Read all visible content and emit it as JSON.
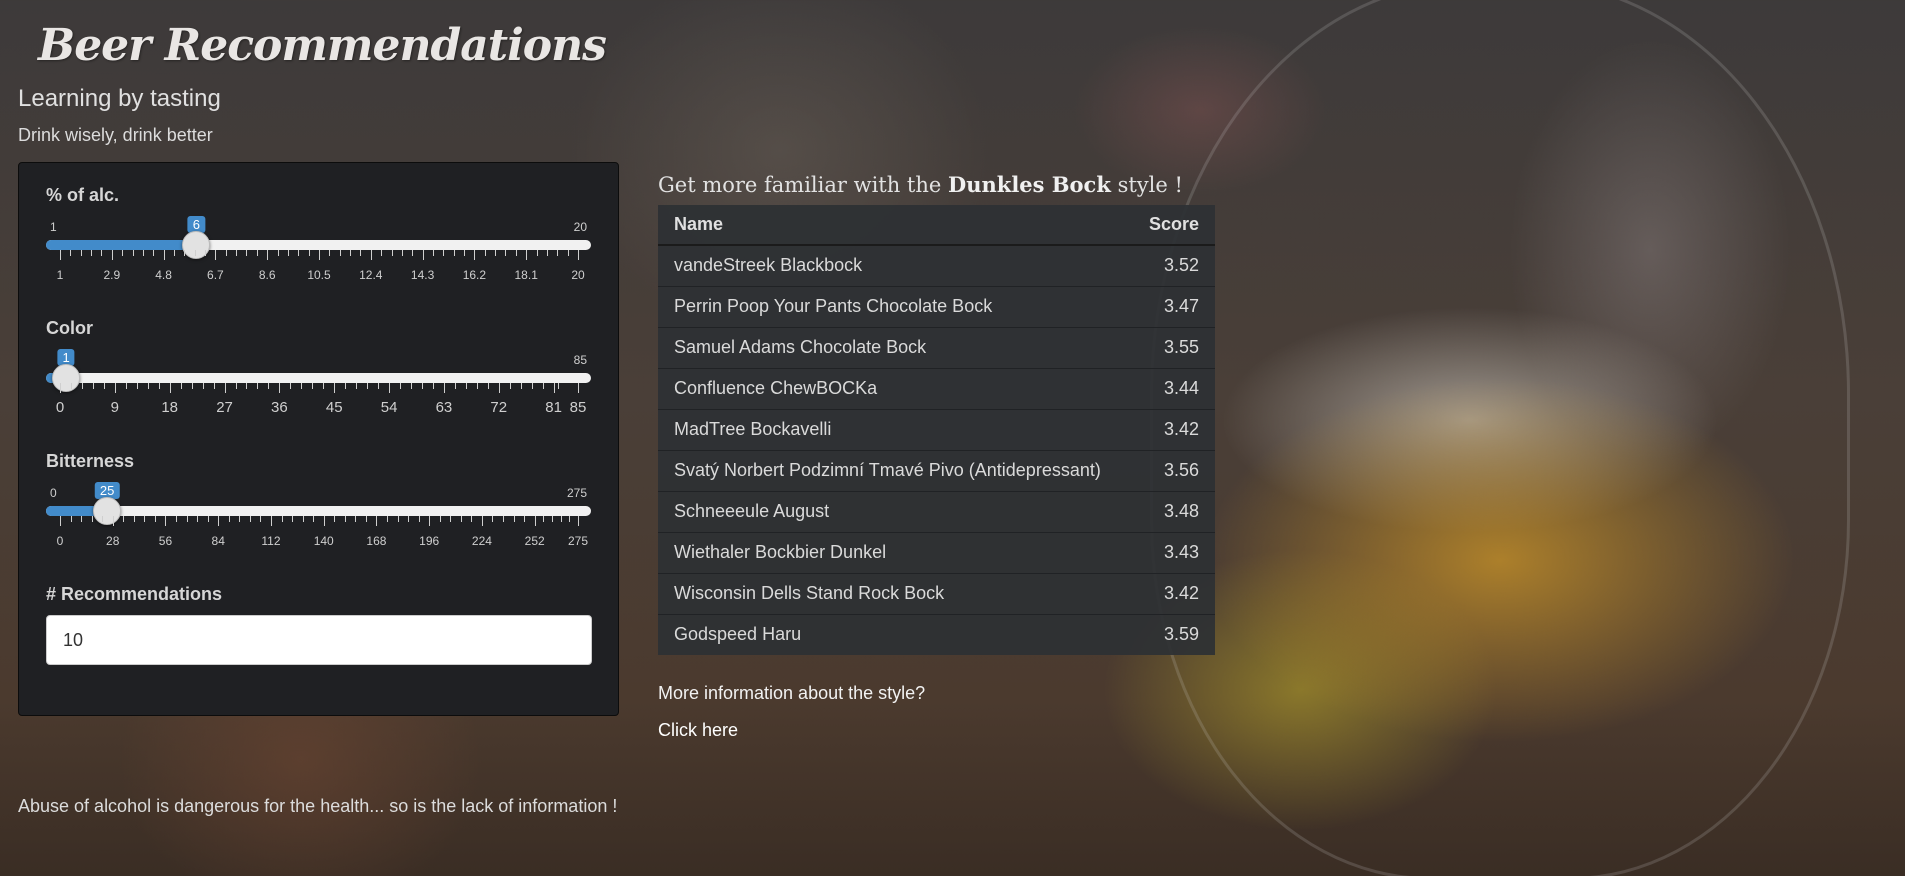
{
  "app": {
    "title": "Beer Recommendations",
    "subtitle": "Learning by tasting",
    "tagline": "Drink wisely, drink better"
  },
  "sidebar": {
    "alcohol": {
      "label": "% of alc.",
      "min": "1",
      "max": "20",
      "value": 6,
      "range_min": 1,
      "range_max": 20,
      "grid": [
        "1",
        "2.9",
        "4.8",
        "6.7",
        "8.6",
        "10.5",
        "12.4",
        "14.3",
        "16.2",
        "18.1",
        "20"
      ]
    },
    "color": {
      "label": "Color",
      "min": "0",
      "max": "85",
      "value": 1,
      "range_min": 0,
      "range_max": 85,
      "grid": [
        "0",
        "9",
        "18",
        "27",
        "36",
        "45",
        "54",
        "63",
        "72",
        "81",
        "85"
      ]
    },
    "bitterness": {
      "label": "Bitterness",
      "min": "0",
      "max": "275",
      "value": 25,
      "range_min": 0,
      "range_max": 275,
      "grid": [
        "0",
        "28",
        "56",
        "84",
        "112",
        "140",
        "168",
        "196",
        "224",
        "252",
        "275"
      ]
    },
    "recommendations": {
      "label": "# Recommendations",
      "value": "10"
    }
  },
  "main": {
    "heading_prefix": "Get more familiar with the",
    "style_name": "Dunkles Bock",
    "heading_suffix": "style !",
    "table": {
      "headers": [
        "Name",
        "Score"
      ],
      "rows": [
        [
          "vandeStreek Blackbock",
          "3.52"
        ],
        [
          "Perrin Poop Your Pants Chocolate Bock",
          "3.47"
        ],
        [
          "Samuel Adams Chocolate Bock",
          "3.55"
        ],
        [
          "Confluence ChewBOCKa",
          "3.44"
        ],
        [
          "MadTree Bockavelli",
          "3.42"
        ],
        [
          "Svatý Norbert Podzimní Tmavé Pivo (Antidepressant)",
          "3.56"
        ],
        [
          "Schneeeule August",
          "3.48"
        ],
        [
          "Wiethaler Bockbier Dunkel",
          "3.43"
        ],
        [
          "Wisconsin Dells Stand Rock Bock",
          "3.42"
        ],
        [
          "Godspeed Haru",
          "3.59"
        ]
      ]
    },
    "more_info": "More information about the style?",
    "link": "Click here"
  },
  "footer": {
    "text": "Abuse of alcohol is dangerous for the health... so is the lack of information !"
  },
  "colors": {
    "accent": "#428bca",
    "panel": "#1f2023"
  }
}
